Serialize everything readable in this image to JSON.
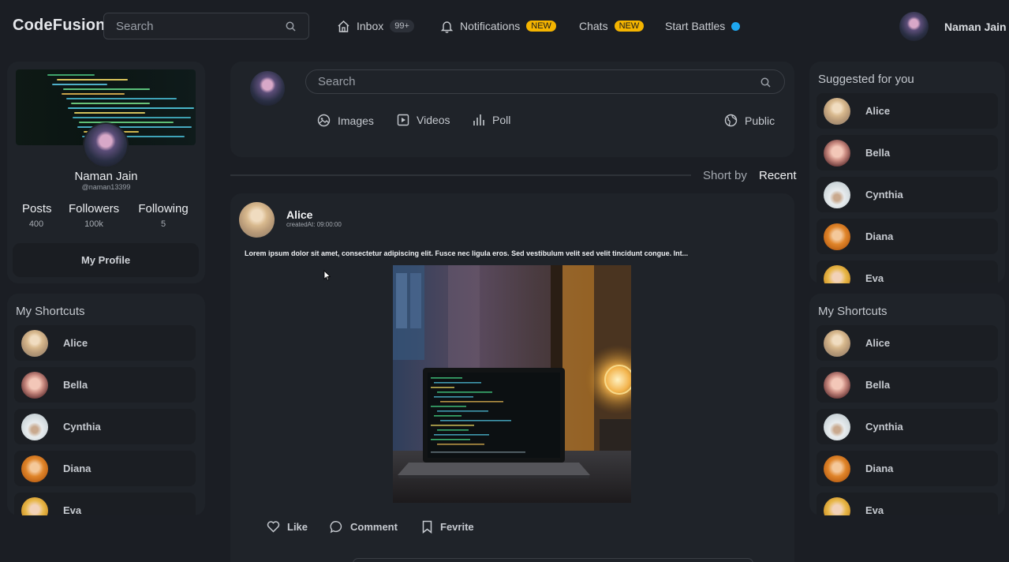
{
  "brand": "CodeFusion",
  "topbar": {
    "search_placeholder": "Search",
    "nav": [
      {
        "label": "Inbox",
        "badge": "99+",
        "icon": "home-icon"
      },
      {
        "label": "Notifications",
        "badge": "NEW",
        "icon": "bell-icon"
      },
      {
        "label": "Chats",
        "badge": "NEW"
      },
      {
        "label": "Start Battles",
        "status": "online-dot"
      }
    ],
    "user_name": "Naman Jain"
  },
  "profile": {
    "name": "Naman Jain",
    "handle": "@naman13399",
    "stats": [
      {
        "label": "Posts",
        "value": "400"
      },
      {
        "label": "Followers",
        "value": "100k"
      },
      {
        "label": "Following",
        "value": "5"
      }
    ],
    "button": "My Profile"
  },
  "shortcuts_left": {
    "title": "My Shortcuts",
    "items": [
      "Alice",
      "Bella",
      "Cynthia",
      "Diana",
      "Eva"
    ]
  },
  "composer": {
    "search_placeholder": "Search",
    "actions": [
      "Images",
      "Videos",
      "Poll"
    ],
    "visibility": "Public"
  },
  "sort": {
    "label": "Short by",
    "value": "Recent"
  },
  "post": {
    "author": "Alice",
    "created": "createdAt: 09:00:00",
    "text": "Lorem ipsum dolor sit amet, consectetur adipiscing elit. Fusce nec ligula eros. Sed vestibulum velit sed velit tincidunt congue. Int...",
    "actions": [
      "Like",
      "Comment",
      "Fevrite"
    ]
  },
  "suggested": {
    "title": "Suggested for you",
    "items": [
      "Alice",
      "Bella",
      "Cynthia",
      "Diana",
      "Eva"
    ]
  },
  "shortcuts_right": {
    "title": "My Shortcuts",
    "items": [
      "Alice",
      "Bella",
      "Cynthia",
      "Diana",
      "Eva"
    ]
  },
  "colors": {
    "background": "#1b1e24",
    "panel": "#1f2329",
    "badge_new": "#f4b400",
    "online_dot": "#1ea7f0"
  }
}
